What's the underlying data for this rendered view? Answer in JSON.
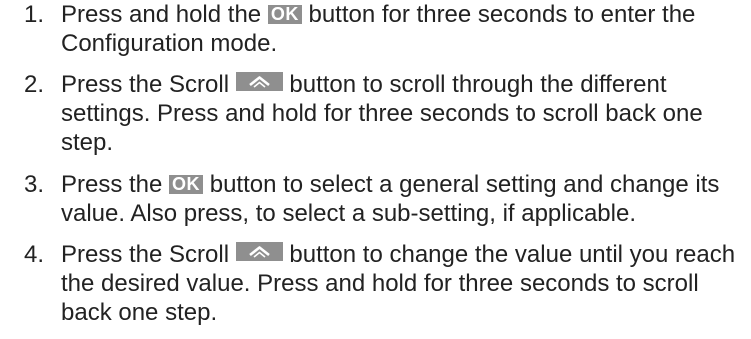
{
  "steps": [
    {
      "number": "1.",
      "before": "Press and hold the ",
      "button": "OK",
      "after": " button for three seconds to enter the Configuration mode."
    },
    {
      "number": "2.",
      "before": "Press the Scroll ",
      "button_icon": "scroll-up-icon",
      "after": " button to scroll through the different settings. Press and hold for three seconds to scroll back one step."
    },
    {
      "number": "3.",
      "before": "Press the ",
      "button": "OK",
      "after": " button to select a general setting and change its value. Also press, to select a sub-setting, if applicable."
    },
    {
      "number": "4.",
      "before": "Press the Scroll ",
      "button_icon": "scroll-up-icon",
      "after": " button to change the value until you reach the desired value. Press and hold for three seconds to scroll back one step."
    }
  ],
  "colors": {
    "text": "#222222",
    "button_background": "#8f8f8f",
    "button_foreground": "#ffffff"
  }
}
